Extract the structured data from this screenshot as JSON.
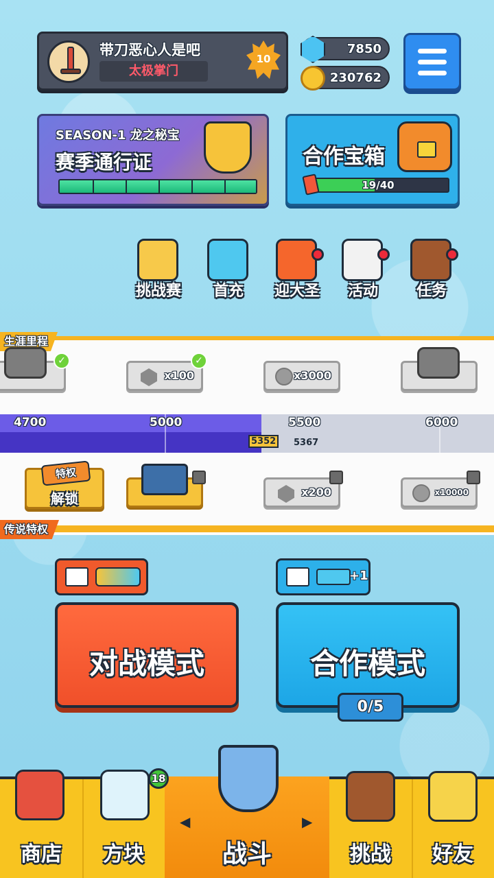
{
  "profile": {
    "player_name": "带刀恶心人是吧",
    "player_title": "太极掌门",
    "level": "10"
  },
  "currency": {
    "gems": "7850",
    "coins": "230762"
  },
  "season_pass": {
    "subtitle": "SEASON-1 龙之秘宝",
    "title": "赛季通行证",
    "progress": 1.0
  },
  "coop_chest": {
    "title": "合作宝箱",
    "progress_text": "19/40",
    "progress": 0.475
  },
  "activities": [
    {
      "label": "挑战赛",
      "has_dot": false
    },
    {
      "label": "首充",
      "has_dot": false
    },
    {
      "label": "迎大圣",
      "has_dot": true
    },
    {
      "label": "活动",
      "has_dot": true
    },
    {
      "label": "任务",
      "has_dot": true
    }
  ],
  "career": {
    "label": "生涯里程",
    "top_rewards": [
      "",
      "x100",
      "x3000",
      ""
    ],
    "milestones": [
      "4700",
      "5000",
      "5500",
      "6000"
    ],
    "current_score": "5352",
    "next_marker": "5367",
    "bottom_rewards": [
      "",
      "x200",
      "x10000"
    ],
    "unlock_tag": "特权",
    "unlock_label": "解锁"
  },
  "legend_privilege": {
    "label": "传说特权"
  },
  "modes": {
    "battle_label": "对战模式",
    "coop_label": "合作模式",
    "coop_count": "0/5",
    "coop_tag_text": "+1"
  },
  "nav": {
    "items": [
      "商店",
      "方块",
      "战斗",
      "挑战",
      "好友"
    ],
    "blocks_badge": "18",
    "active": "战斗"
  },
  "colors": {
    "battle": "#f0502a",
    "coop": "#1da6e6",
    "nav": "#f8c420",
    "progress": "#6c5ce7"
  }
}
